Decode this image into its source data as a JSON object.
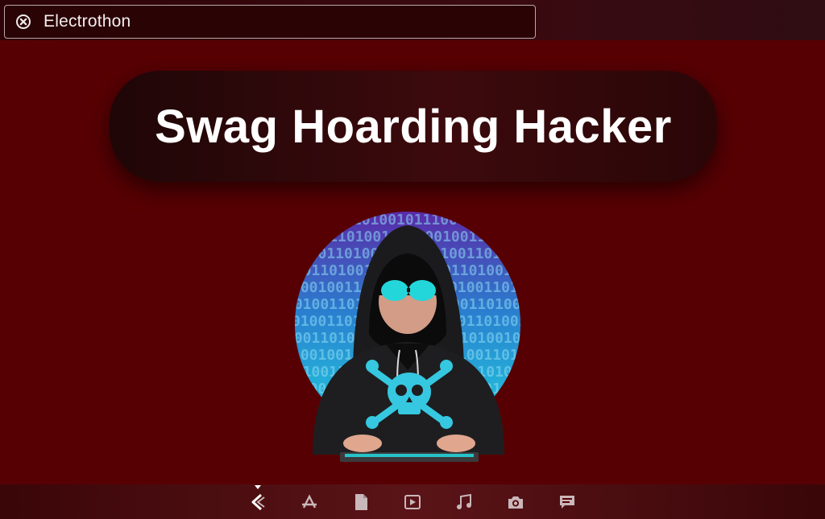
{
  "window": {
    "title": "Electrothon",
    "close_icon": "close-circle-icon"
  },
  "main": {
    "banner_text": "Swag Hoarding Hacker",
    "image_alt": "hacker-illustration",
    "image_text": "1001001101001011"
  },
  "dock": {
    "items": [
      {
        "name": "launcher-icon",
        "active": true
      },
      {
        "name": "app-store-icon",
        "active": false
      },
      {
        "name": "document-icon",
        "active": false
      },
      {
        "name": "video-player-icon",
        "active": false
      },
      {
        "name": "music-icon",
        "active": false
      },
      {
        "name": "camera-icon",
        "active": false
      },
      {
        "name": "chat-icon",
        "active": false
      }
    ]
  },
  "colors": {
    "background": "#560004",
    "topbar": "#2e0306",
    "banner": "#2c0709",
    "banner_text": "#ffffff",
    "circle_top": "#5a2aa8",
    "circle_bottom": "#1fd3df",
    "skull": "#35c8e0"
  }
}
